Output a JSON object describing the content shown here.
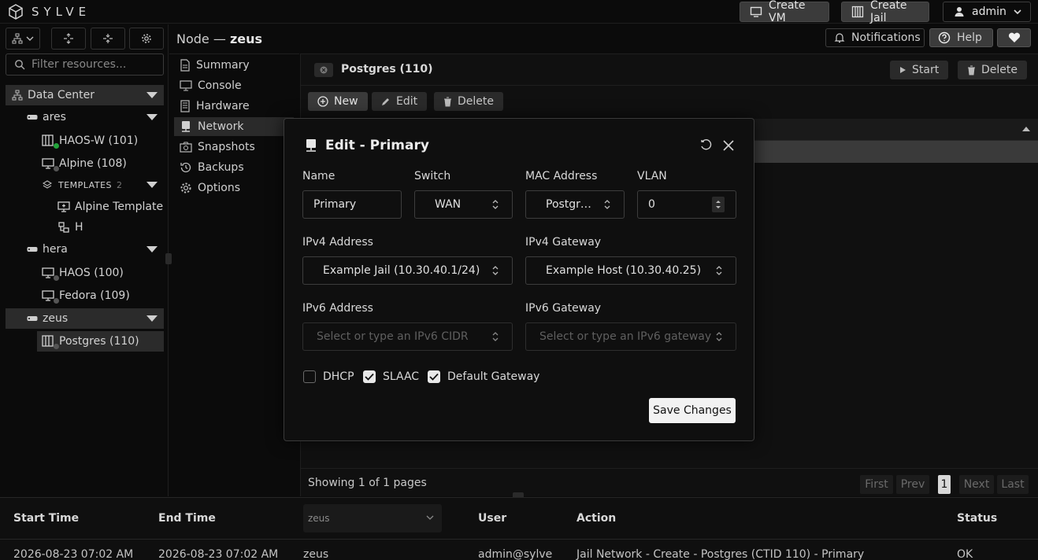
{
  "brand": {
    "name": "SYLVE"
  },
  "topbar": {
    "create_vm": "Create VM",
    "create_jail": "Create Jail",
    "user": "admin"
  },
  "sidebar": {
    "filter_placeholder": "Filter resources...",
    "datacenter": "Data Center",
    "nodes": [
      {
        "name": "ares",
        "items": [
          "HAOS-W (101)",
          "Alpine (108)"
        ],
        "templates_label": "TEMPLATES",
        "templates_count": "2",
        "templates": [
          "Alpine Template",
          "H"
        ]
      },
      {
        "name": "hera",
        "items": [
          "HAOS (100)",
          "Fedora (109)"
        ]
      },
      {
        "name": "zeus",
        "items": [
          "Postgres (110)"
        ]
      }
    ]
  },
  "node_header": {
    "prefix": "Node — ",
    "name": "zeus"
  },
  "header_buttons": {
    "notifications": "Notifications",
    "help": "Help"
  },
  "nav": [
    "Summary",
    "Console",
    "Hardware",
    "Network",
    "Snapshots",
    "Backups",
    "Options"
  ],
  "main": {
    "title": "Postgres (110)",
    "start": "Start",
    "delete": "Delete",
    "toolbar": {
      "new": "New",
      "edit": "Edit",
      "delete": "Delete"
    },
    "pager": {
      "status": "Showing 1 of 1 pages",
      "first": "First",
      "prev": "Prev",
      "page": "1",
      "next": "Next",
      "last": "Last"
    }
  },
  "modal": {
    "title": "Edit - Primary",
    "labels": {
      "name": "Name",
      "switch": "Switch",
      "mac": "MAC Address",
      "vlan": "VLAN",
      "ipv4": "IPv4 Address",
      "ipv4gw": "IPv4 Gateway",
      "ipv6": "IPv6 Address",
      "ipv6gw": "IPv6 Gateway"
    },
    "values": {
      "name": "Primary",
      "switch": "WAN",
      "mac": "Postgr…",
      "vlan": "0",
      "ipv4": "Example Jail (10.30.40.1/24)",
      "ipv4gw": "Example Host (10.30.40.25)"
    },
    "placeholders": {
      "ipv6": "Select or type an IPv6 CIDR",
      "ipv6gw": "Select or type an IPv6 gateway"
    },
    "checks": {
      "dhcp": "DHCP",
      "slaac": "SLAAC",
      "default_gateway": "Default Gateway"
    },
    "check_states": {
      "dhcp": false,
      "slaac": true,
      "default_gateway": true
    },
    "save": "Save Changes"
  },
  "log": {
    "headers": {
      "start": "Start Time",
      "end": "End Time",
      "node_filter": "zeus",
      "user": "User",
      "action": "Action",
      "status": "Status"
    },
    "row": {
      "start": "2026-08-23 07:02 AM",
      "end": "2026-08-23 07:02 AM",
      "node": "zeus",
      "user": "admin@sylve",
      "action": "Jail Network - Create - Postgres (CTID 110) - Primary",
      "status": "OK"
    }
  }
}
